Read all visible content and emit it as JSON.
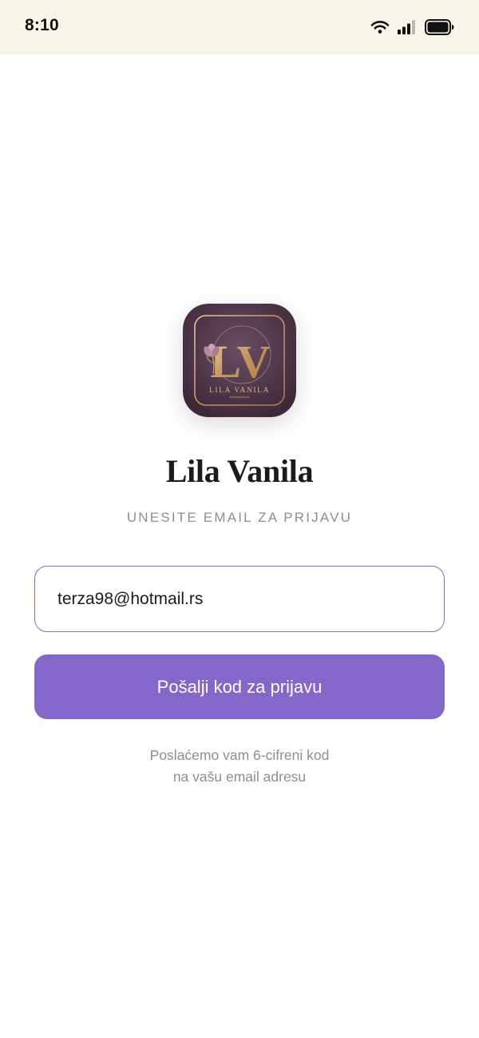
{
  "status_bar": {
    "time": "8:10"
  },
  "app": {
    "name": "Lila Vanila",
    "logo": {
      "initials": "LV",
      "wordmark": "LILA VANILA"
    }
  },
  "login": {
    "subtitle": "UNESITE EMAIL ZA PRIJAVU",
    "email_value": "terza98@hotmail.rs",
    "send_button_label": "Pošalji kod za prijavu",
    "helper_line_1": "Poslaćemo vam 6-cifreni kod",
    "helper_line_2": "na vašu email adresu"
  },
  "colors": {
    "status_bar_bg": "#f8f4ea",
    "accent": "#8467c8",
    "input_border": "#8a6ac3",
    "logo_bg": "#4a3446",
    "logo_gold": "#c9a070"
  },
  "icons": [
    "wifi-icon",
    "cellular-signal-icon",
    "battery-icon",
    "flower-icon"
  ]
}
